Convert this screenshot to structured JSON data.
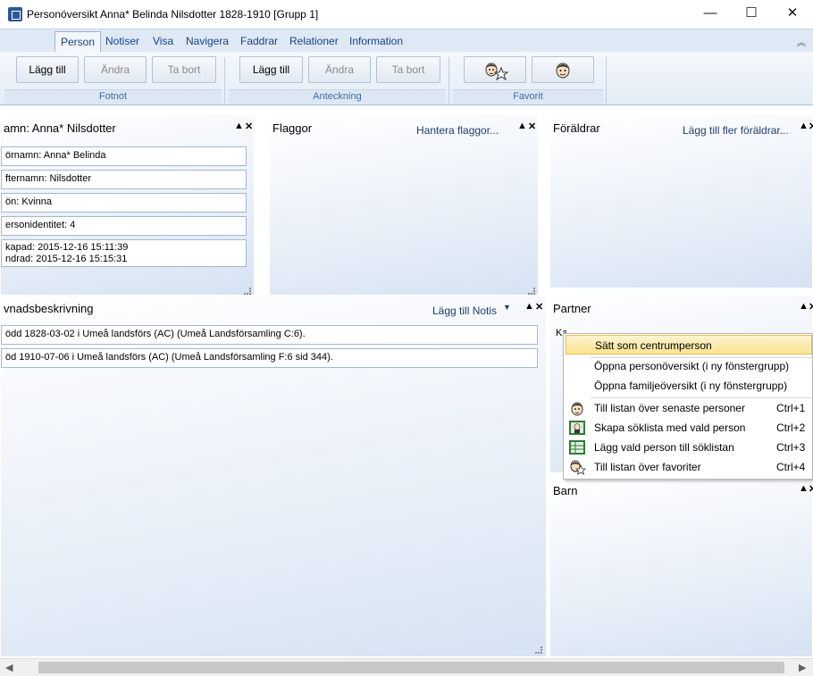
{
  "window": {
    "title": "Personöversikt Anna* Belinda Nilsdotter 1828-1910 [Grupp 1]",
    "minimize": "—",
    "maximize": "☐",
    "close": "✕"
  },
  "ribbon": {
    "tabs": [
      "Person",
      "Notiser",
      "Visa",
      "Navigera",
      "Faddrar",
      "Relationer",
      "Information"
    ],
    "groups": {
      "fotnot": {
        "label": "Fotnot",
        "add": "Lägg till",
        "edit": "Ändra",
        "remove": "Ta bort"
      },
      "anteckning": {
        "label": "Anteckning",
        "add": "Lägg till",
        "edit": "Ändra",
        "remove": "Ta bort"
      },
      "favorit": {
        "label": "Favorit"
      }
    }
  },
  "panels": {
    "namn": {
      "title": "amn: Anna* Nilsdotter",
      "fields": [
        "örnamn: Anna* Belinda",
        "fternamn: Nilsdotter",
        "ön: Kvinna",
        "ersonidentitet: 4"
      ],
      "created": "kapad: 2015-12-16 15:11:39",
      "changed": "ndrad: 2015-12-16 15:15:31"
    },
    "flaggor": {
      "title": "Flaggor",
      "link": "Hantera flaggor..."
    },
    "foraldrar": {
      "title": "Föräldrar",
      "link": "Lägg till fler föräldrar..."
    },
    "levnad": {
      "title": "vnadsbeskrivning",
      "link": "Lägg till Notis",
      "rows": [
        "ödd 1828-03-02 i Umeå landsförs (AC) (Umeå Landsförsamling C:6).",
        "öd 1910-07-06 i Umeå landsförs (AC) (Umeå Landsförsamling F:6 sid  344)."
      ]
    },
    "partner": {
      "title": "Partner",
      "row_partial": "Ka"
    },
    "barn": {
      "title": "Barn"
    }
  },
  "context_menu": {
    "items": [
      {
        "label": "Sätt som centrumperson",
        "shortcut": ""
      },
      {
        "label": "Öppna personöversikt (i ny fönstergrupp)",
        "shortcut": ""
      },
      {
        "label": "Öppna familjeöversikt (i ny fönstergrupp)",
        "shortcut": ""
      },
      {
        "label": "Till listan över senaste personer",
        "shortcut": "Ctrl+1"
      },
      {
        "label": "Skapa söklista med vald person",
        "shortcut": "Ctrl+2"
      },
      {
        "label": "Lägg vald person till söklistan",
        "shortcut": "Ctrl+3"
      },
      {
        "label": "Till listan över favoriter",
        "shortcut": "Ctrl+4"
      }
    ]
  },
  "colors": {
    "accent": "#15428b",
    "panel": "#d6e3f3",
    "highlight": "#fce491"
  }
}
